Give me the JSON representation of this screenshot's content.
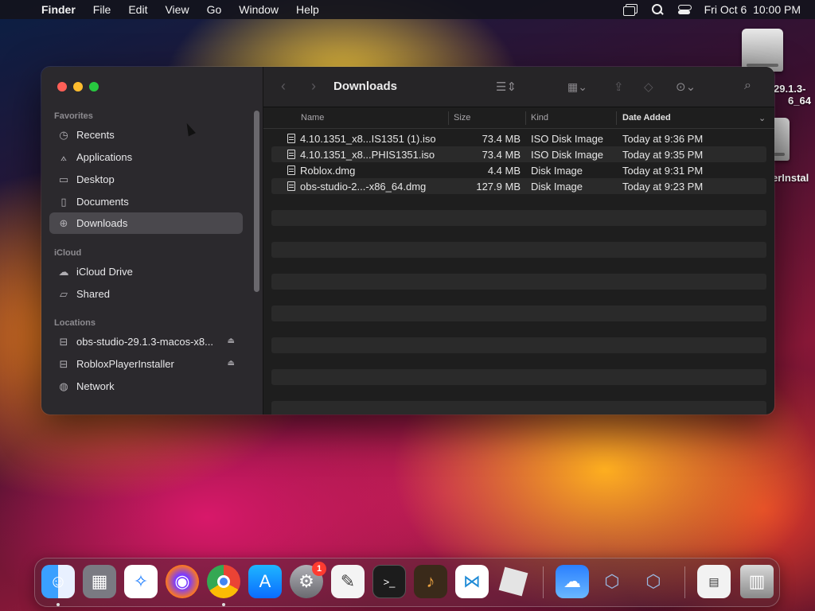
{
  "menubar": {
    "app": "Finder",
    "items": [
      "File",
      "Edit",
      "View",
      "Go",
      "Window",
      "Help"
    ],
    "datetime": "Fri Oct 6  10:00 PM"
  },
  "desktop": {
    "items": [
      {
        "label_line1": "29.1.3-",
        "label_line2": "6_64"
      },
      {
        "label_line1": "erInstal",
        "label_line2": ""
      }
    ]
  },
  "finder": {
    "title": "Downloads",
    "sidebar": {
      "favorites_header": "Favorites",
      "favorites": [
        {
          "label": "Recents",
          "icon": "clock-icon"
        },
        {
          "label": "Applications",
          "icon": "applications-icon"
        },
        {
          "label": "Desktop",
          "icon": "desktop-icon"
        },
        {
          "label": "Documents",
          "icon": "document-icon"
        },
        {
          "label": "Downloads",
          "icon": "download-icon",
          "selected": true
        }
      ],
      "icloud_header": "iCloud",
      "icloud": [
        {
          "label": "iCloud Drive",
          "icon": "cloud-icon"
        },
        {
          "label": "Shared",
          "icon": "shared-folder-icon"
        }
      ],
      "locations_header": "Locations",
      "locations": [
        {
          "label": "obs-studio-29.1.3-macos-x8...",
          "icon": "drive-icon",
          "eject": true
        },
        {
          "label": "RobloxPlayerInstaller",
          "icon": "drive-icon",
          "eject": true
        },
        {
          "label": "Network",
          "icon": "globe-icon"
        }
      ]
    },
    "columns": {
      "name": "Name",
      "size": "Size",
      "kind": "Kind",
      "date_added": "Date Added"
    },
    "files": [
      {
        "name": "4.10.1351_x8...IS1351 (1).iso",
        "size": "73.4 MB",
        "kind": "ISO Disk Image",
        "date": "Today at 9:36 PM"
      },
      {
        "name": "4.10.1351_x8...PHIS1351.iso",
        "size": "73.4 MB",
        "kind": "ISO Disk Image",
        "date": "Today at 9:35 PM"
      },
      {
        "name": "Roblox.dmg",
        "size": "4.4 MB",
        "kind": "Disk Image",
        "date": "Today at 9:31 PM"
      },
      {
        "name": "obs-studio-2...-x86_64.dmg",
        "size": "127.9 MB",
        "kind": "Disk Image",
        "date": "Today at 9:23 PM"
      }
    ]
  },
  "dock": {
    "settings_badge": "1",
    "apps": [
      "finder-icon",
      "launchpad-icon",
      "safari-icon",
      "firefox-icon",
      "chrome-icon",
      "app-store-icon",
      "system-settings-icon",
      "textedit-icon",
      "terminal-icon",
      "garageband-icon",
      "vscode-icon",
      "roblox-icon",
      "weather-icon",
      "virtualbox-icon",
      "virtualbox-vm-icon",
      "chrome-app-icon",
      "trash-icon"
    ]
  },
  "colors": {
    "selection": "#4a484d",
    "badge": "#ff3b30"
  }
}
